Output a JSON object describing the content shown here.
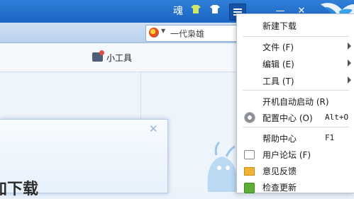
{
  "titlebar": {
    "skin_char": "魂",
    "icons": [
      "skin-icon",
      "tshirt-green-icon",
      "tshirt-white-icon",
      "menu-icon",
      "minimize-icon",
      "close-icon",
      "bird-logo-icon"
    ],
    "minimize_glyph": "—",
    "close_glyph": "✕"
  },
  "search": {
    "text": "一代枭雄",
    "engine_icon": "engine-logo-icon"
  },
  "toolbar": {
    "tools_label": "小工具"
  },
  "dialog": {
    "title": "加下载",
    "close_glyph": "✕"
  },
  "menu": {
    "items": [
      {
        "label": "新建下载"
      },
      {
        "label": "文件 (F)",
        "submenu": true
      },
      {
        "label": "编辑 (E)",
        "submenu": true
      },
      {
        "label": "工具 (T)",
        "submenu": true
      },
      {
        "label": "开机自动启动 (R)"
      },
      {
        "label": "配置中心 (O)",
        "shortcut": "Alt+O",
        "icon": "gear-icon"
      },
      {
        "label": "帮助中心",
        "shortcut": "F1"
      },
      {
        "label": "用户论坛 (F)",
        "icon": "forum-icon"
      },
      {
        "label": "意见反馈",
        "icon": "envelope-icon"
      },
      {
        "label": "检查更新",
        "icon": "update-icon"
      }
    ]
  },
  "colors": {
    "titlebar": "#2f7ed8",
    "accent": "#1b65c2",
    "menu_bg": "#ffffff"
  }
}
